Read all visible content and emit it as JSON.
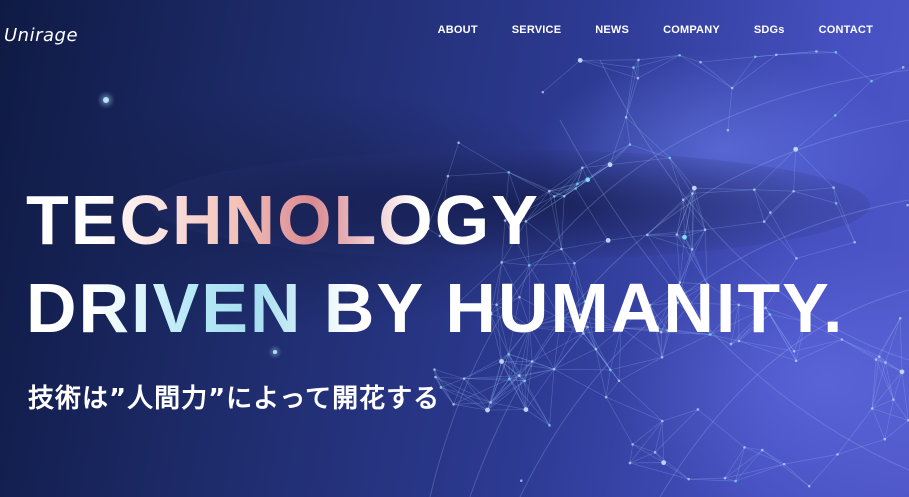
{
  "brand": {
    "logo_text": "Unirage"
  },
  "nav": {
    "items": [
      "ABOUT",
      "SERVICE",
      "NEWS",
      "COMPANY",
      "SDGs",
      "CONTACT"
    ]
  },
  "hero": {
    "headline_line1": "TECHNOLOGY",
    "headline_line2": "DRIVEN BY HUMANITY.",
    "subheadline": "技術は”人間力”によって開花する"
  },
  "colors": {
    "background_dark": "#0f1a44",
    "background_light": "#5058c8",
    "accent_pink": "#f3c1b9",
    "accent_cyan": "#b7e9f6",
    "text": "#ffffff"
  }
}
